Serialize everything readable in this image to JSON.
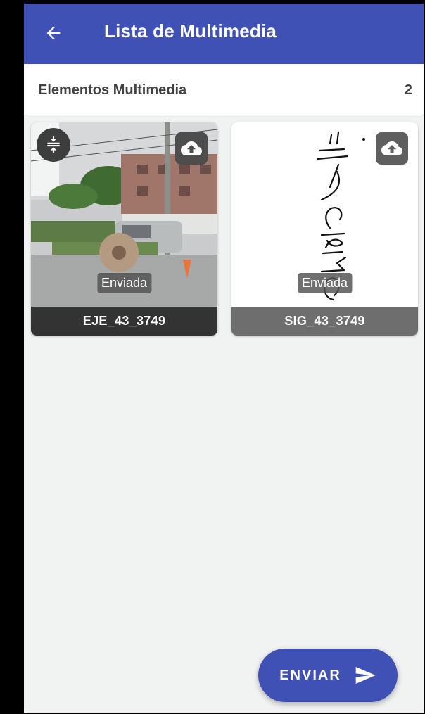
{
  "appbar": {
    "title": "Lista de Multimedia",
    "back_icon": "arrow-left-icon",
    "color": "#3f51b5"
  },
  "section": {
    "title": "Elementos Multimedia",
    "count": "2"
  },
  "items": [
    {
      "name": "EJE_43_3749",
      "status": "Enviada",
      "image": "street-photo",
      "actions": [
        "compress-icon",
        "cloud-upload-icon"
      ]
    },
    {
      "name": "SIG_43_3749",
      "status": "Enviada",
      "image": "handwritten-signature",
      "actions": [
        "cloud-upload-icon"
      ]
    }
  ],
  "fab": {
    "label": "ENVIAR",
    "icon": "send-icon"
  }
}
